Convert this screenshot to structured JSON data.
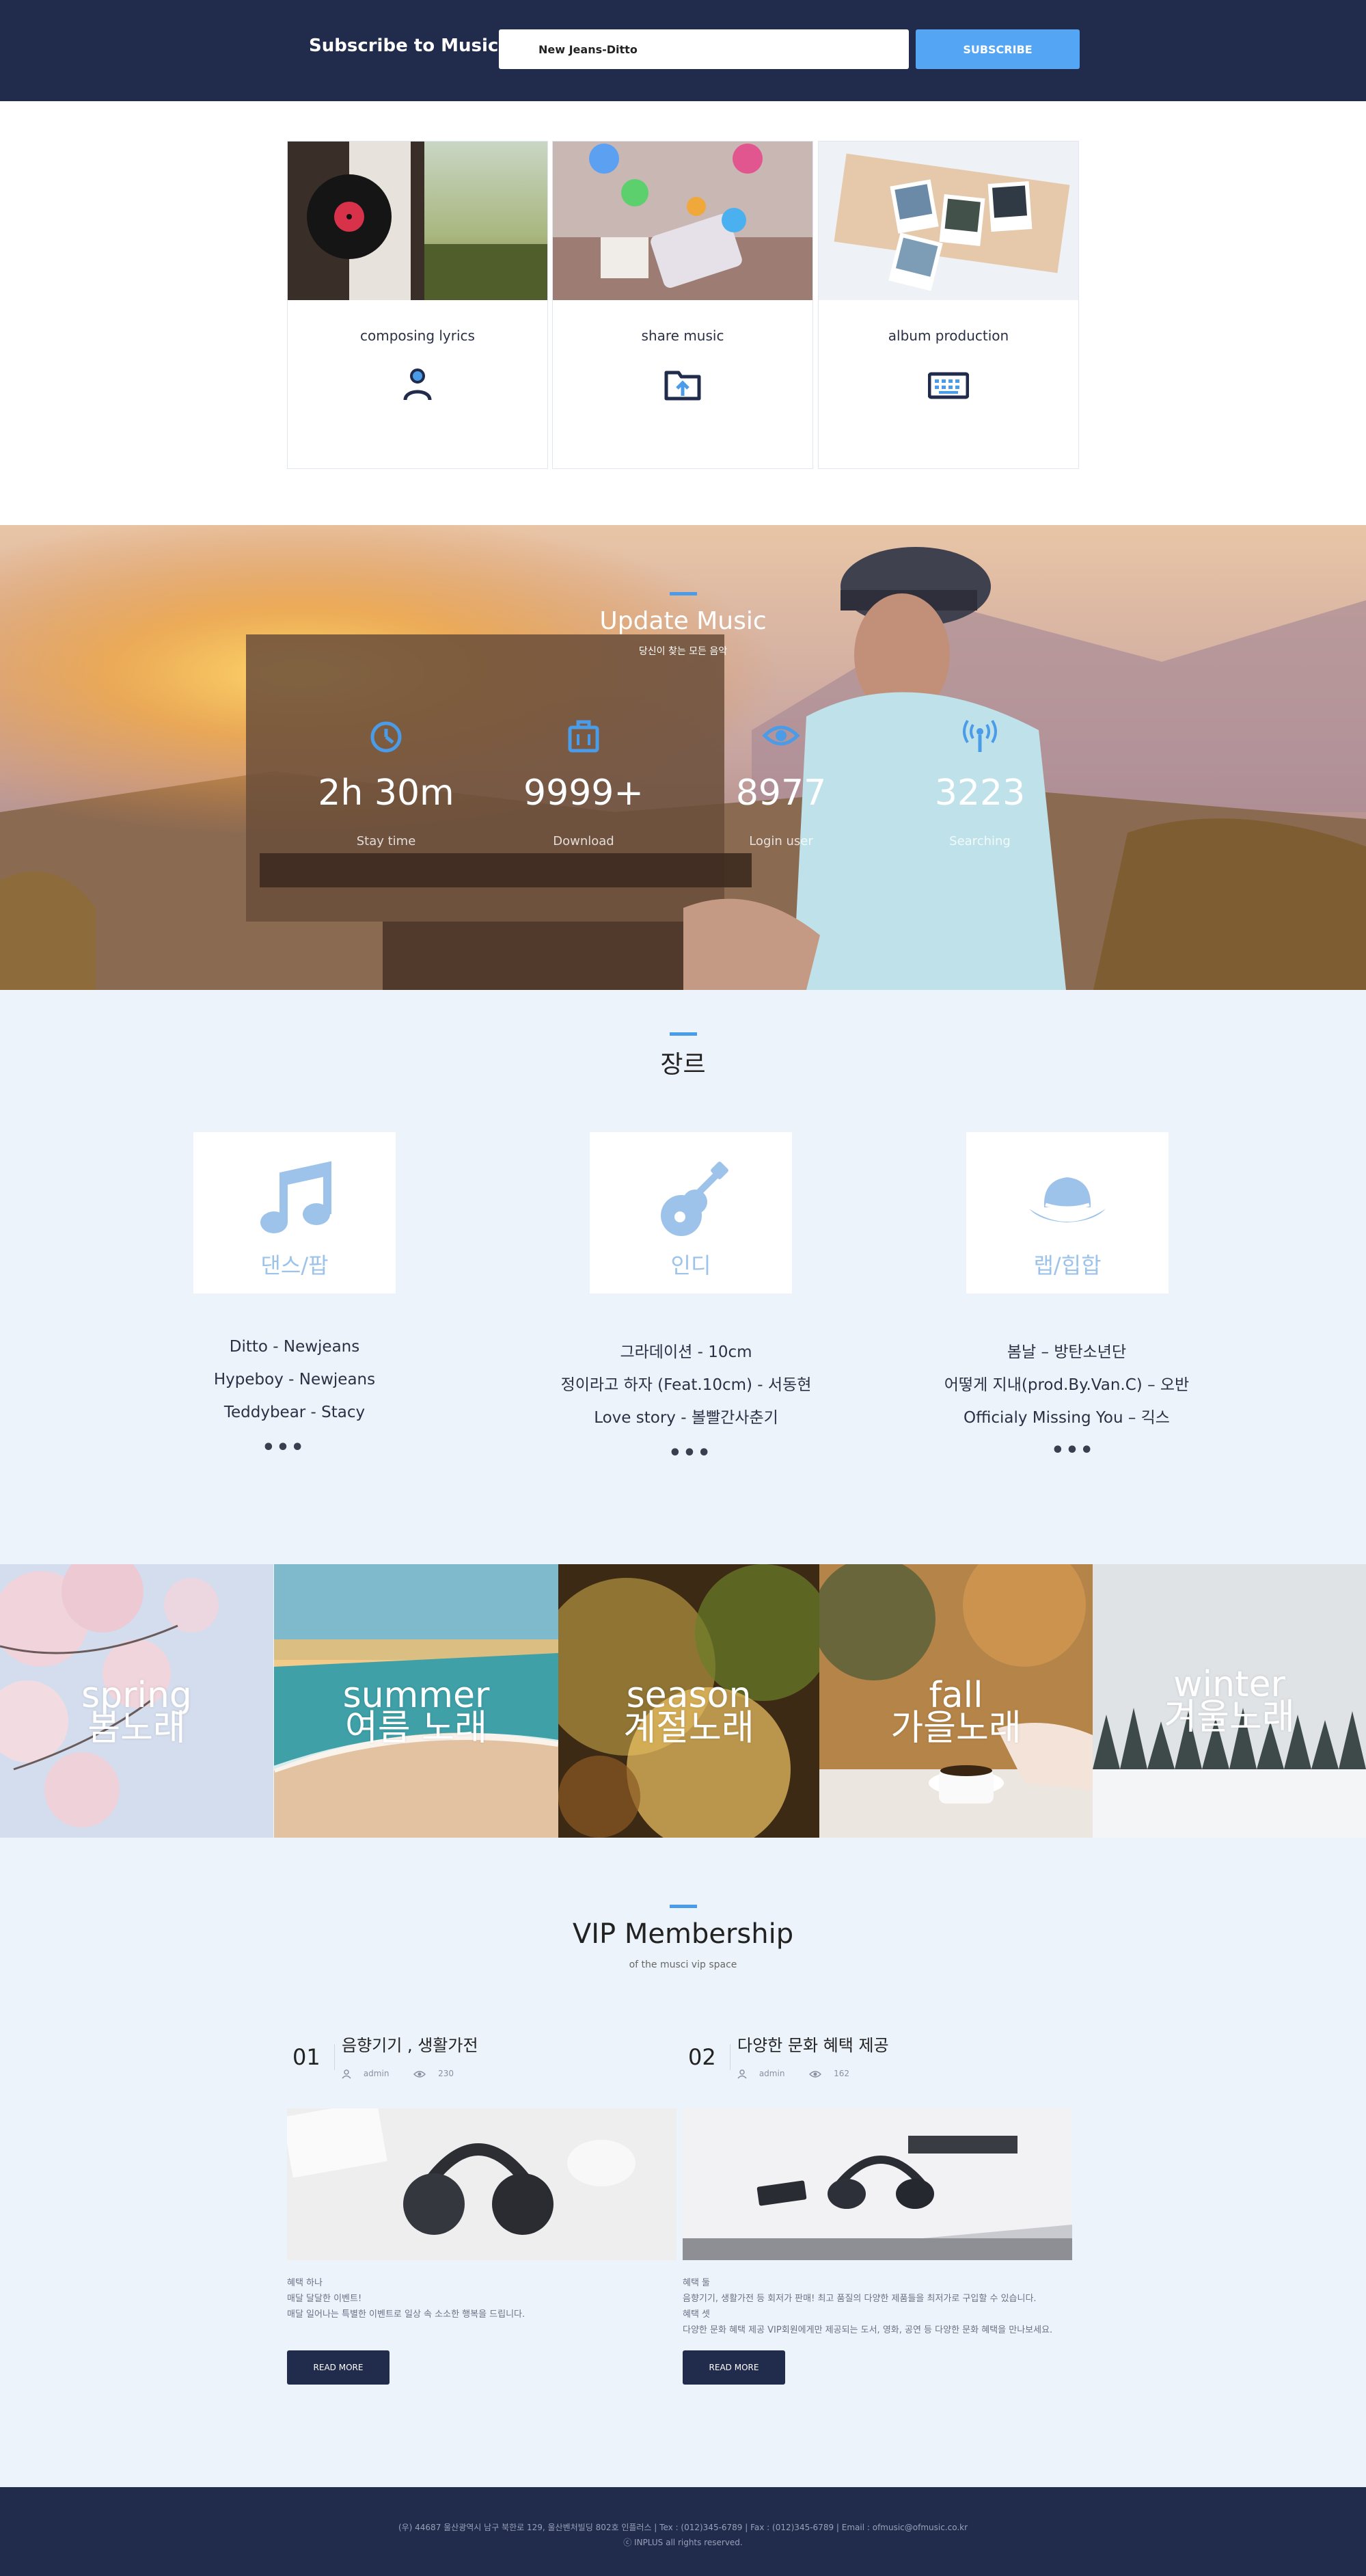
{
  "subscribe": {
    "title": "Subscribe to Music",
    "input_value": "New Jeans-Ditto",
    "button": "SUBSCRIBE"
  },
  "services": [
    {
      "title": "composing lyrics",
      "icon": "person-icon"
    },
    {
      "title": "share music",
      "icon": "folder-upload-icon"
    },
    {
      "title": "album production",
      "icon": "keyboard-icon"
    }
  ],
  "update": {
    "title": "Update Music",
    "subtitle": "당신이 찾는 모든 음악",
    "stats": [
      {
        "value": "2h 30m",
        "label": "Stay time",
        "icon": "clock-icon"
      },
      {
        "value": "9999+",
        "label": "Download",
        "icon": "bag-icon"
      },
      {
        "value": "8977",
        "label": "Login user",
        "icon": "eye-icon"
      },
      {
        "value": "3223",
        "label": "Searching",
        "icon": "broadcast-icon"
      }
    ]
  },
  "genre": {
    "title": "장르",
    "cards": [
      {
        "label": "댄스/팝",
        "icon": "music-note-icon",
        "songs": [
          "Ditto - Newjeans",
          "Hypeboy - Newjeans",
          "Teddybear - Stacy"
        ],
        "more": "•••"
      },
      {
        "label": "인디",
        "icon": "guitar-icon",
        "songs": [
          "그라데이션 - 10cm",
          "정이라고 하자 (Feat.10cm) - 서동현",
          "Love story - 볼빨간사춘기"
        ],
        "more": "•••"
      },
      {
        "label": "랩/힙합",
        "icon": "hat-icon",
        "songs": [
          "봄날 – 방탄소년단",
          "어떻게 지내(prod.By.Van.C) – 오반",
          "Officialy Missing You – 긱스"
        ],
        "more": "•••"
      }
    ]
  },
  "seasons": [
    {
      "en": "spring",
      "ko": "봄노래"
    },
    {
      "en": "summer",
      "ko": "여름 노래"
    },
    {
      "en": "season",
      "ko": "계절노래"
    },
    {
      "en": "fall",
      "ko": "가을노래"
    },
    {
      "en": "winter",
      "ko": "겨울노래"
    }
  ],
  "vip": {
    "title": "VIP Membership",
    "subtitle": "of the musci vip space",
    "posts": [
      {
        "num": "01",
        "title": "음향기기 , 생활가전",
        "author": "admin",
        "views": "230",
        "desc": [
          "혜택 하나",
          "매달 달달한 이벤트!",
          "매달 일어나는 특별한 이벤트로 일상 속 소소한 행복을 드립니다."
        ],
        "button": "READ MORE"
      },
      {
        "num": "02",
        "title": "다양한 문화 혜택 제공",
        "author": "admin",
        "views": "162",
        "desc": [
          "혜택 둘",
          "음향기기, 생활가전 등 회저가 판매! 최고 품질의 다양한 제품들을 최저가로 구입할 수 있습니다.",
          "혜택 셋",
          "다양한 문화 혜택 제공 VIP회원에게만 제공되는 도서, 영화, 공연 등 다양한 문화 혜택을 만나보세요."
        ],
        "button": "READ MORE"
      }
    ]
  },
  "footer": {
    "line1": "(우) 44687  울산광역시 남구 북한로 129, 울산벤처빌딩 802호 인플러스   |   Tex : (012)345-6789   |   Fax : (012)345-6789   |   Email : ofmusic@ofmusic.co.kr",
    "line2": "ⓒ INPLUS all rights reserved."
  },
  "colors": {
    "navy": "#212b4c",
    "accent": "#54a6f5",
    "light_bg": "#edf3fb"
  }
}
